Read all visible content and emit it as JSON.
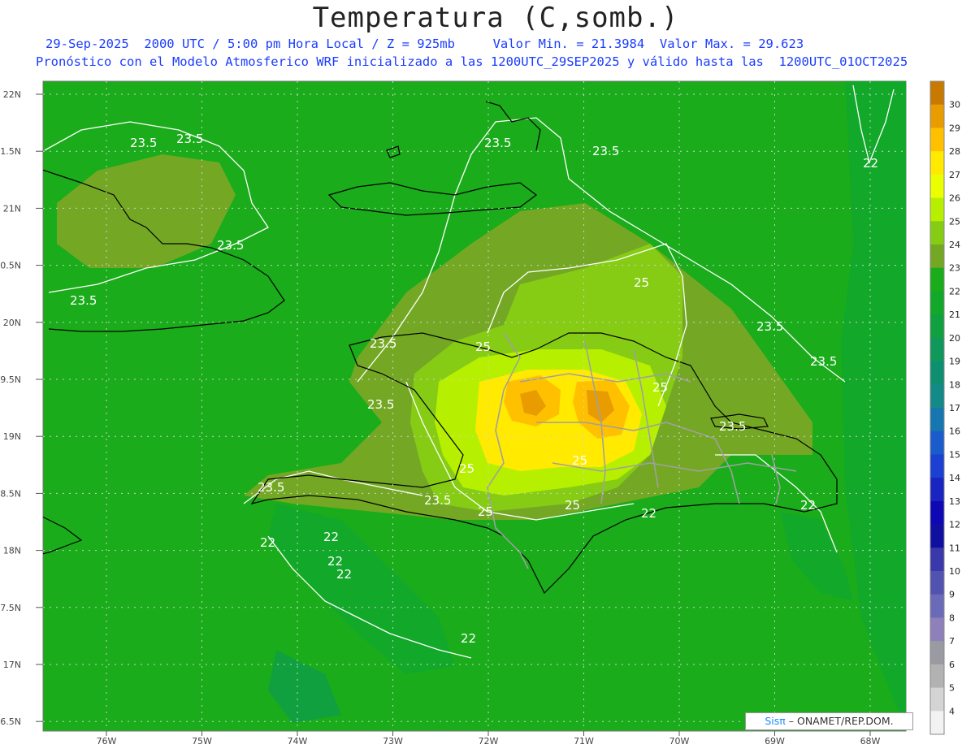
{
  "header": {
    "title": "Temperatura (C,somb.)",
    "subtitle_1": "29-Sep-2025  2000 UTC / 5:00 pm Hora Local / Z = 925mb     Valor Min. = 21.3984  Valor Max. = 29.623",
    "subtitle_2": "Pronóstico con el Modelo Atmosferico WRF inicializado a las 1200UTC_29SEP2025 y válido hasta las  1200UTC_01OCT2025"
  },
  "axes": {
    "lat_labels": [
      "22N",
      "1.5N",
      "21N",
      "0.5N",
      "20N",
      "9.5N",
      "19N",
      "8.5N",
      "18N",
      "7.5N",
      "17N",
      "6.5N"
    ],
    "lon_labels": [
      "76W",
      "75W",
      "74W",
      "73W",
      "72W",
      "71W",
      "70W",
      "69W",
      "68W"
    ]
  },
  "contour_labels": [
    "23.5",
    "23.5",
    "23.5",
    "23.5",
    "23.5",
    "23.5",
    "23.5",
    "23.5",
    "23.5",
    "23.5",
    "23.5",
    "23.5",
    "23.5",
    "25",
    "25",
    "25",
    "25",
    "25",
    "25",
    "25",
    "22",
    "22",
    "22",
    "22",
    "22",
    "22",
    "22",
    "22"
  ],
  "colorbar": {
    "labels": [
      "30",
      "29",
      "28",
      "27",
      "26",
      "25",
      "24",
      "23",
      "22",
      "21",
      "20",
      "19",
      "18",
      "17",
      "16",
      "15",
      "14",
      "13",
      "12",
      "11",
      "10",
      "9",
      "8",
      "7",
      "6",
      "5",
      "4"
    ],
    "colors": [
      "#c87a00",
      "#e89c00",
      "#ffc000",
      "#ffea00",
      "#eaff00",
      "#b6f000",
      "#86cc14",
      "#74a824",
      "#1aac1a",
      "#12a82a",
      "#10a040",
      "#10985a",
      "#0e9070",
      "#148a88",
      "#1676b0",
      "#1a5ccc",
      "#1c40d2",
      "#1a24c0",
      "#0e08b4",
      "#1010a0",
      "#3a38aa",
      "#5252b0",
      "#6a6ab8",
      "#8e80ba",
      "#9a9aa2",
      "#b2b2b2",
      "#d4d4d4",
      "#f2f2f2"
    ]
  },
  "credit": {
    "brand": "Sisπ",
    "text": " – ONAMET/REP.DOM."
  },
  "colors": {
    "field_base": "#1aac1a",
    "coast": "#000000",
    "borders": "#a0a0a0",
    "contour": "#ffffff"
  }
}
